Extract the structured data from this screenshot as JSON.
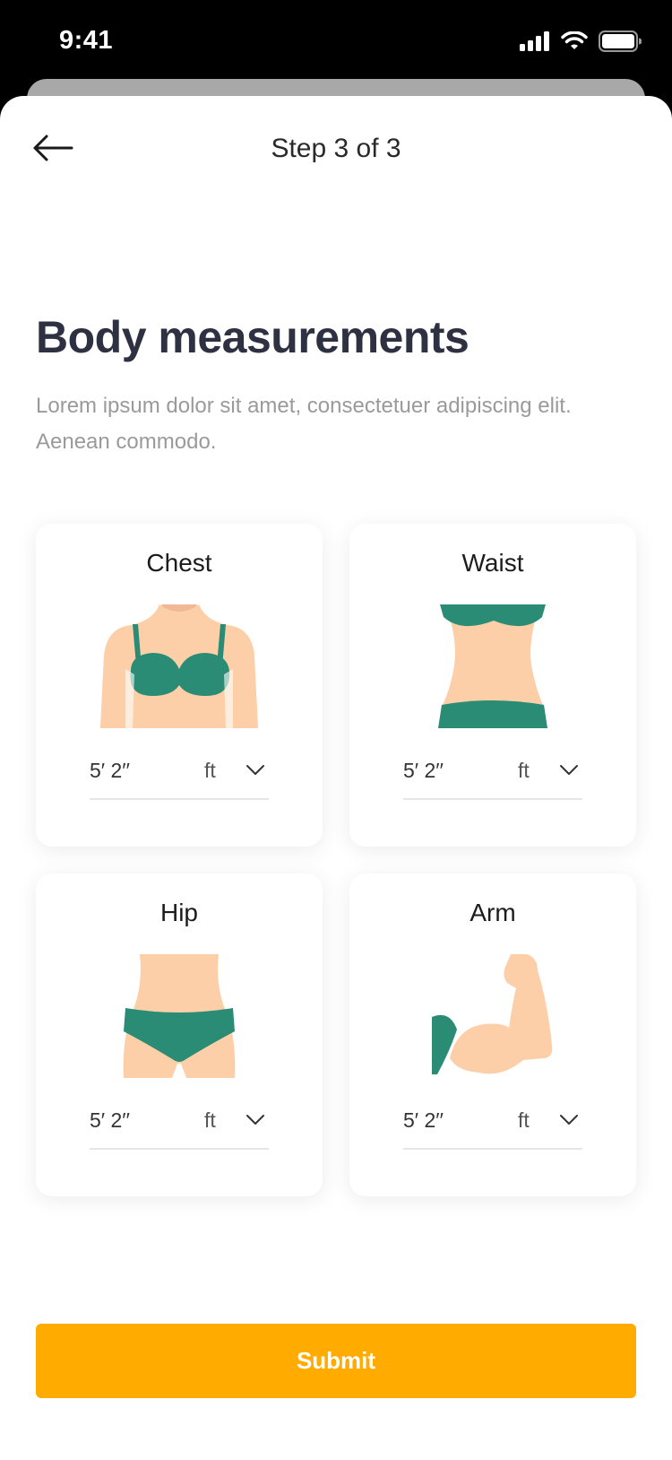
{
  "status_bar": {
    "time": "9:41"
  },
  "header": {
    "step_label": "Step 3 of 3"
  },
  "main": {
    "title": "Body measurements",
    "description": "Lorem ipsum dolor sit amet, consectetuer adipiscing elit. Aenean commodo."
  },
  "cards": [
    {
      "title": "Chest",
      "value": "5′ 2′′",
      "unit": "ft"
    },
    {
      "title": "Waist",
      "value": "5′ 2′′",
      "unit": "ft"
    },
    {
      "title": "Hip",
      "value": "5′ 2′′",
      "unit": "ft"
    },
    {
      "title": "Arm",
      "value": "5′ 2′′",
      "unit": "ft"
    }
  ],
  "footer": {
    "submit_label": "Submit"
  },
  "colors": {
    "accent": "#ffab00",
    "garment": "#2a8c74",
    "skin": "#fdcfa8",
    "title": "#2e3142"
  },
  "icons": [
    "back-arrow-icon",
    "chevron-down-icon",
    "signal-icon",
    "wifi-icon",
    "battery-icon"
  ]
}
